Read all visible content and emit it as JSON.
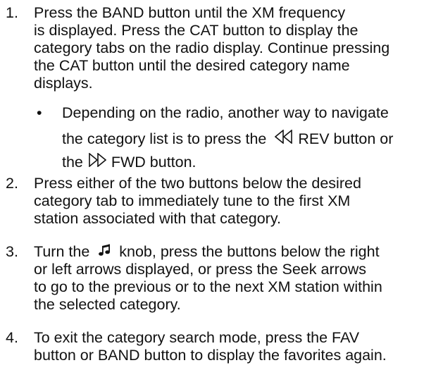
{
  "steps": [
    {
      "number": "1.",
      "lines": [
        "Press the BAND button until the XM frequency",
        "is displayed. Press the CAT button to display the",
        "category tabs on the radio display. Continue pressing",
        "the CAT button until the desired category name",
        "displays."
      ],
      "bullet": {
        "symbol": "•",
        "line1": "Depending on the radio, another way to navigate",
        "line2_before": "the category list is to press the",
        "rev_icon": "rewind-icon",
        "line2_after": "REV button or",
        "line3_before": "the",
        "fwd_icon": "fast-forward-icon",
        "line3_after": "FWD button."
      }
    },
    {
      "number": "2.",
      "lines": [
        "Press either of the two buttons below the desired",
        "category tab to immediately tune to the first XM",
        "station associated with that category."
      ]
    },
    {
      "number": "3.",
      "line1_before": "Turn the",
      "knob_icon": "music-note-icon",
      "line1_after": "knob, press the buttons below the right",
      "lines": [
        "or left arrows displayed, or press the Seek arrows",
        "to go to the previous or to the next XM station within",
        "the selected category."
      ]
    },
    {
      "number": "4.",
      "lines": [
        "To exit the category search mode, press the FAV",
        "button or BAND button to display the favorites again."
      ]
    }
  ]
}
